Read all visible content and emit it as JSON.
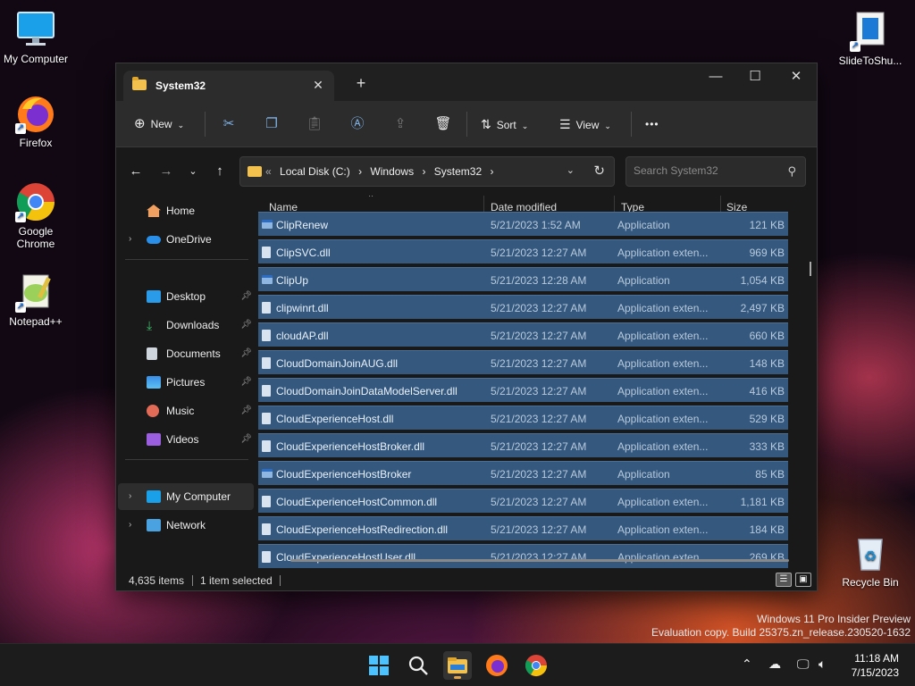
{
  "desktop": {
    "icons": [
      {
        "label": "My Computer",
        "icon": "monitor-icon"
      },
      {
        "label": "Firefox",
        "icon": "firefox-icon"
      },
      {
        "label": "Google Chrome",
        "icon": "chrome-icon"
      },
      {
        "label": "Notepad++",
        "icon": "notepad-plus-plus-icon"
      },
      {
        "label": "SlideToShu...",
        "icon": "slide-to-shutdown-icon"
      },
      {
        "label": "Recycle Bin",
        "icon": "recycle-bin-icon"
      }
    ],
    "watermark": {
      "line1": "Windows 11 Pro Insider Preview",
      "line2": "Evaluation copy. Build 25375.zn_release.230520-1632"
    }
  },
  "window": {
    "tab_title": "System32",
    "tab_close": "✕",
    "new_tab": "+",
    "controls": {
      "minimize": "—",
      "maximize": "☐",
      "close": "✕"
    },
    "toolbar": {
      "new_label": "New",
      "sort_label": "Sort",
      "view_label": "View",
      "more_label": "•••"
    },
    "address": {
      "overflow": "«",
      "crumbs": [
        "Local Disk (C:)",
        "Windows",
        "System32"
      ],
      "separator": "›"
    },
    "search_placeholder": "Search System32",
    "sidebar": {
      "items": [
        {
          "label": "Home",
          "pinned": false,
          "expandable": false
        },
        {
          "label": "OneDrive",
          "pinned": false,
          "expandable": true
        },
        {
          "label": "Desktop",
          "pinned": true,
          "expandable": false
        },
        {
          "label": "Downloads",
          "pinned": true,
          "expandable": false
        },
        {
          "label": "Documents",
          "pinned": true,
          "expandable": false
        },
        {
          "label": "Pictures",
          "pinned": true,
          "expandable": false
        },
        {
          "label": "Music",
          "pinned": true,
          "expandable": false
        },
        {
          "label": "Videos",
          "pinned": true,
          "expandable": false
        },
        {
          "label": "My Computer",
          "pinned": false,
          "expandable": true
        },
        {
          "label": "Network",
          "pinned": false,
          "expandable": true
        }
      ]
    },
    "columns": [
      "Name",
      "Date modified",
      "Type",
      "Size"
    ],
    "files": [
      {
        "name": "ClipRenew",
        "date": "5/21/2023 1:52 AM",
        "type": "Application",
        "size": "121 KB",
        "kind": "app"
      },
      {
        "name": "ClipSVC.dll",
        "date": "5/21/2023 12:27 AM",
        "type": "Application exten...",
        "size": "969 KB",
        "kind": "dll"
      },
      {
        "name": "ClipUp",
        "date": "5/21/2023 12:28 AM",
        "type": "Application",
        "size": "1,054 KB",
        "kind": "app"
      },
      {
        "name": "clipwinrt.dll",
        "date": "5/21/2023 12:27 AM",
        "type": "Application exten...",
        "size": "2,497 KB",
        "kind": "dll"
      },
      {
        "name": "cloudAP.dll",
        "date": "5/21/2023 12:27 AM",
        "type": "Application exten...",
        "size": "660 KB",
        "kind": "dll"
      },
      {
        "name": "CloudDomainJoinAUG.dll",
        "date": "5/21/2023 12:27 AM",
        "type": "Application exten...",
        "size": "148 KB",
        "kind": "dll"
      },
      {
        "name": "CloudDomainJoinDataModelServer.dll",
        "date": "5/21/2023 12:27 AM",
        "type": "Application exten...",
        "size": "416 KB",
        "kind": "dll"
      },
      {
        "name": "CloudExperienceHost.dll",
        "date": "5/21/2023 12:27 AM",
        "type": "Application exten...",
        "size": "529 KB",
        "kind": "dll"
      },
      {
        "name": "CloudExperienceHostBroker.dll",
        "date": "5/21/2023 12:27 AM",
        "type": "Application exten...",
        "size": "333 KB",
        "kind": "dll"
      },
      {
        "name": "CloudExperienceHostBroker",
        "date": "5/21/2023 12:27 AM",
        "type": "Application",
        "size": "85 KB",
        "kind": "app"
      },
      {
        "name": "CloudExperienceHostCommon.dll",
        "date": "5/21/2023 12:27 AM",
        "type": "Application exten...",
        "size": "1,181 KB",
        "kind": "dll"
      },
      {
        "name": "CloudExperienceHostRedirection.dll",
        "date": "5/21/2023 12:27 AM",
        "type": "Application exten...",
        "size": "184 KB",
        "kind": "dll"
      },
      {
        "name": "CloudExperienceHostUser.dll",
        "date": "5/21/2023 12:27 AM",
        "type": "Application exten...",
        "size": "269 KB",
        "kind": "dll"
      }
    ],
    "status": {
      "items_count": "4,635 items",
      "selected": "1 item selected"
    }
  },
  "taskbar": {
    "apps": [
      "start-icon",
      "search-icon",
      "file-explorer-icon",
      "firefox-icon",
      "chrome-icon"
    ],
    "clock": {
      "time": "11:18 AM",
      "date": "7/15/2023"
    }
  },
  "colors": {
    "selection": "#34587e",
    "window_bg": "#191919",
    "toolbar_bg": "#2c2c2c",
    "folder": "#f2c14e",
    "taskbar_bg": "#1c1c1c"
  }
}
